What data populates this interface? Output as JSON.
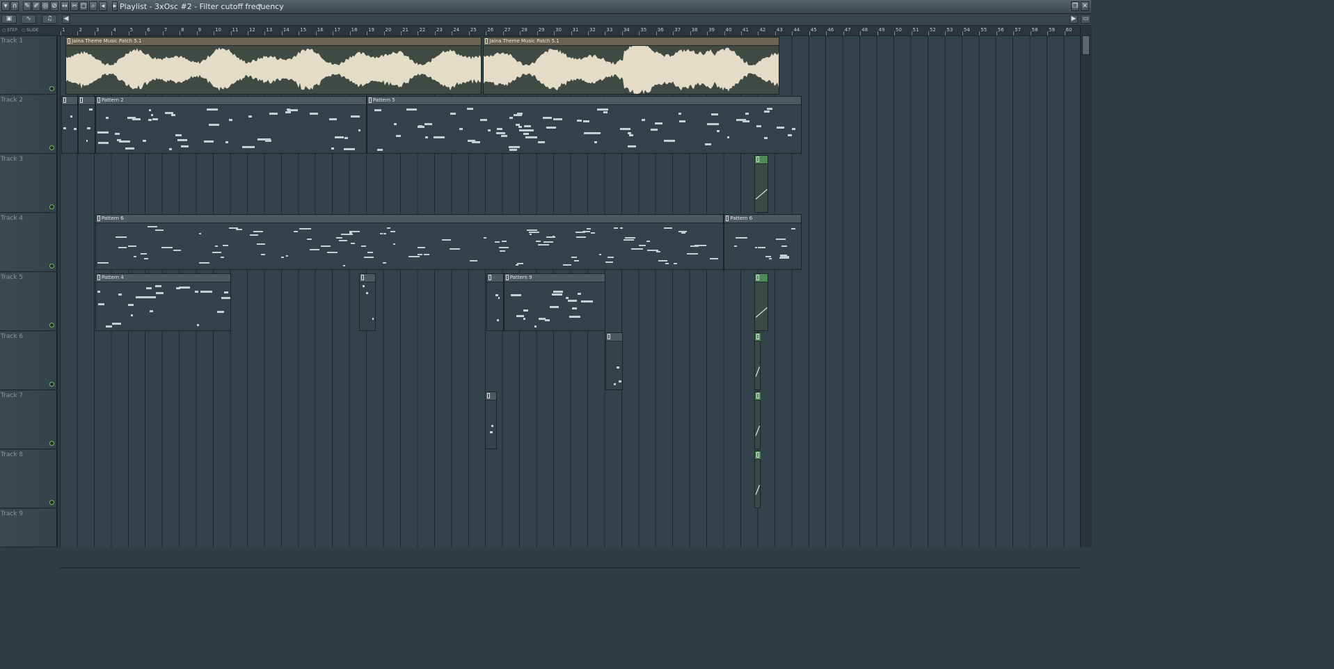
{
  "window": {
    "title": "Playlist - 3xOsc #2 - Filter cutoff frequency",
    "dropdown_icon": "triangle-down-icon"
  },
  "toolbar": {
    "icons": [
      "menu-icon",
      "magnet-icon",
      "pencil-icon",
      "paint-icon",
      "delete-icon",
      "mute-icon",
      "slip-icon",
      "slice-icon",
      "select-icon",
      "zoom-icon",
      "playback-icon"
    ]
  },
  "mode": {
    "step": "STEP",
    "slide": "SLIDE"
  },
  "ruler": {
    "bars": [
      "1",
      "2",
      "3",
      "4",
      "5",
      "6",
      "7",
      "8",
      "9",
      "10",
      "11",
      "12",
      "13",
      "14",
      "15",
      "16",
      "17",
      "18",
      "19",
      "20",
      "21",
      "22",
      "23",
      "24",
      "25",
      "26",
      "27",
      "28",
      "29",
      "30",
      "31",
      "32",
      "33",
      "34",
      "35",
      "36",
      "37",
      "38",
      "39",
      "40",
      "41",
      "42",
      "43",
      "44",
      "45",
      "46",
      "47",
      "48",
      "49",
      "50",
      "51",
      "52",
      "53",
      "54",
      "55",
      "56",
      "57",
      "58",
      "59",
      "60"
    ]
  },
  "tracks": [
    {
      "name": "Track 1"
    },
    {
      "name": "Track 2"
    },
    {
      "name": "Track 3"
    },
    {
      "name": "Track 4"
    },
    {
      "name": "Track 5"
    },
    {
      "name": "Track 6"
    },
    {
      "name": "Track 7"
    },
    {
      "name": "Track 8"
    },
    {
      "name": "Track 9"
    }
  ],
  "clips": [
    {
      "track": 1,
      "kind": "audio",
      "label": "Jaina Theme Music Patch 5.1",
      "start": 1.25,
      "end": 25.7
    },
    {
      "track": 1,
      "kind": "audio",
      "label": "Jaina Theme Music Patch 5.1",
      "start": 25.8,
      "end": 43.2
    },
    {
      "track": 2,
      "kind": "pattern",
      "label": "",
      "start": 1.0,
      "end": 2.0
    },
    {
      "track": 2,
      "kind": "pattern",
      "label": "",
      "start": 2.0,
      "end": 3.0
    },
    {
      "track": 2,
      "kind": "pattern",
      "label": "Pattern 2",
      "start": 3.0,
      "end": 18.95
    },
    {
      "track": 2,
      "kind": "pattern",
      "label": "Pattern 5",
      "start": 18.95,
      "end": 44.5
    },
    {
      "track": 3,
      "kind": "automation",
      "label": "",
      "start": 41.75,
      "end": 42.55
    },
    {
      "track": 4,
      "kind": "pattern",
      "label": "Pattern 6",
      "start": 3.0,
      "end": 39.95
    },
    {
      "track": 4,
      "kind": "pattern",
      "label": "Pattern 6",
      "start": 39.95,
      "end": 44.5
    },
    {
      "track": 5,
      "kind": "pattern",
      "label": "Pattern 4",
      "start": 3.0,
      "end": 11.0
    },
    {
      "track": 5,
      "kind": "pattern",
      "label": "",
      "start": 18.5,
      "end": 19.5
    },
    {
      "track": 5,
      "kind": "pattern",
      "label": "",
      "start": 26.0,
      "end": 27.0
    },
    {
      "track": 5,
      "kind": "pattern",
      "label": "Pattern 9",
      "start": 27.0,
      "end": 33.0
    },
    {
      "track": 5,
      "kind": "automation",
      "label": "",
      "start": 41.75,
      "end": 42.55
    },
    {
      "track": 6,
      "kind": "pattern",
      "label": "",
      "start": 33.0,
      "end": 34.0
    },
    {
      "track": 6,
      "kind": "automation",
      "label": "",
      "start": 41.75,
      "end": 42.1
    },
    {
      "track": 7,
      "kind": "pattern",
      "label": "",
      "start": 25.9,
      "end": 26.6
    },
    {
      "track": 7,
      "kind": "automation",
      "label": "",
      "start": 41.75,
      "end": 42.1
    },
    {
      "track": 8,
      "kind": "automation",
      "label": "",
      "start": 41.75,
      "end": 42.1
    }
  ],
  "colors": {
    "grid": "#33434b",
    "audio_head": "#6b6450",
    "waveform": "#e4dcc6",
    "automation_head": "#4e8a55",
    "note": "#c6cfd4"
  }
}
